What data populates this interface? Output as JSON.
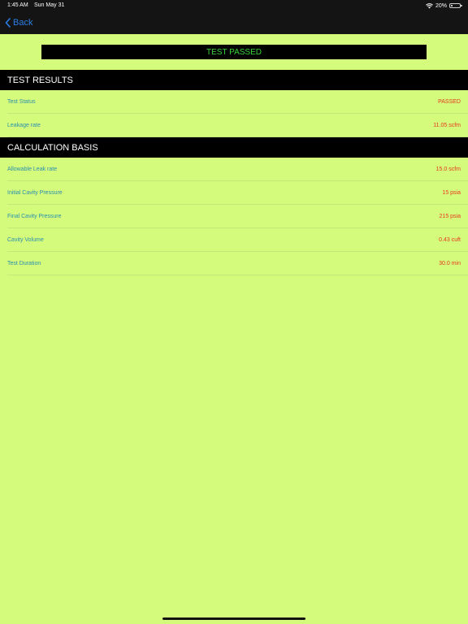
{
  "status_bar": {
    "time": "1:45 AM",
    "date": "Sun May 31",
    "battery_percent": "20%",
    "battery_level": 0.2,
    "wifi_icon": "wifi-icon",
    "battery_icon": "battery-icon"
  },
  "nav": {
    "back_label": "Back",
    "back_icon": "chevron-left-icon",
    "accent_color": "#2a7ee6"
  },
  "banner": {
    "text": "TEST PASSED",
    "text_color": "#39d53a"
  },
  "test_results": {
    "header": "TEST RESULTS",
    "rows": [
      {
        "label": "Test Status",
        "value": "PASSED"
      },
      {
        "label": "Leakage rate",
        "value": "11.05 scfm"
      }
    ]
  },
  "calculation_basis": {
    "header": "CALCULATION BASIS",
    "rows": [
      {
        "label": "Allowable Leak rate",
        "value": "15.0 scfm"
      },
      {
        "label": "Initial Cavity Pressure",
        "value": "15 psia"
      },
      {
        "label": "Final Cavity Pressure",
        "value": "215 psia"
      },
      {
        "label": "Cavity Volume",
        "value": "0.43 cuft"
      },
      {
        "label": "Test Duration",
        "value": "30.0 min"
      }
    ]
  },
  "colors": {
    "background": "#d4fb7b",
    "label": "#2a8fb0",
    "value": "#e8391f"
  }
}
